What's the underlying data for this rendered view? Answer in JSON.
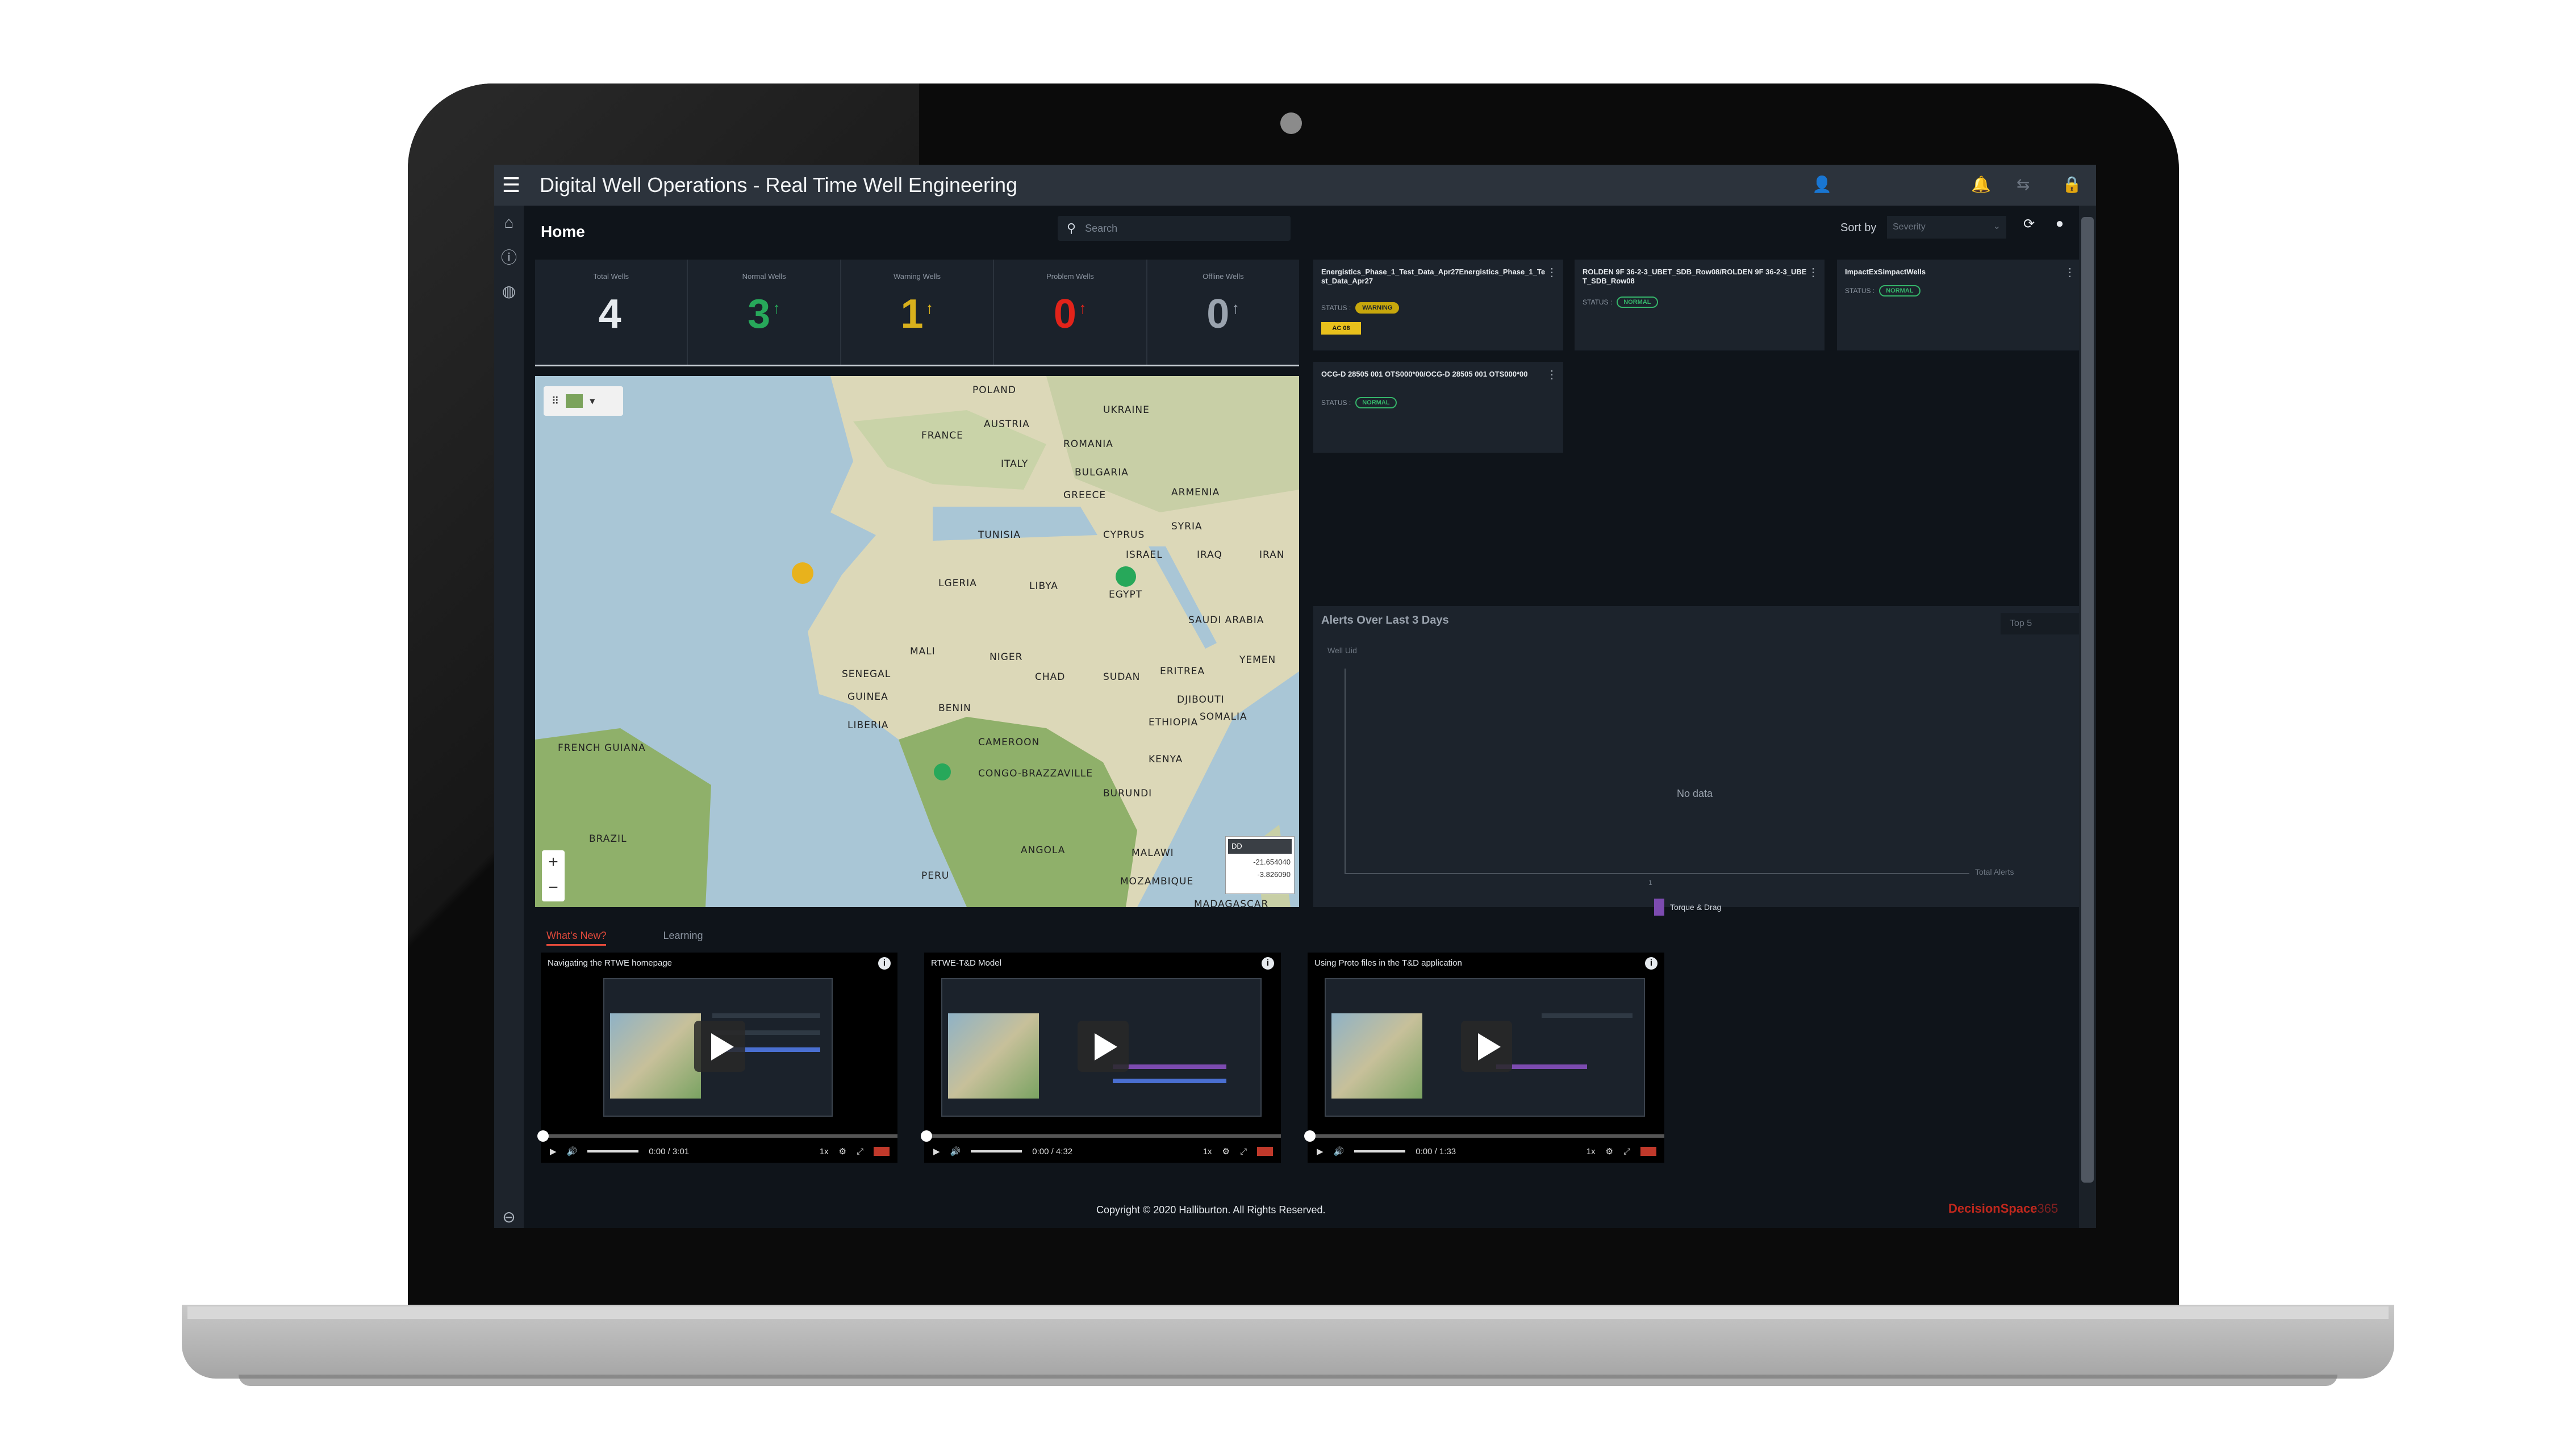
{
  "app": {
    "title": "Digital Well Operations - Real Time Well Engineering",
    "page": "Home",
    "search_placeholder": "Search",
    "sort_label": "Sort by",
    "sort_value": "Severity"
  },
  "kpis": [
    {
      "label": "Total Wells",
      "value": "4",
      "arrow": "",
      "color": "#e6eaee"
    },
    {
      "label": "Normal Wells",
      "value": "3",
      "arrow": "↑",
      "color": "#27a85a"
    },
    {
      "label": "Warning Wells",
      "value": "1",
      "arrow": "↑",
      "color": "#d8b01c"
    },
    {
      "label": "Problem Wells",
      "value": "0",
      "arrow": "↑",
      "color": "#e2231a"
    },
    {
      "label": "Offline Wells",
      "value": "0",
      "arrow": "↑",
      "color": "#9aa3ae"
    }
  ],
  "map": {
    "labels": [
      "POLAND",
      "UKRAINE",
      "FRANCE",
      "AUSTRIA",
      "ROMANIA",
      "ITALY",
      "BULGARIA",
      "GREECE",
      "ARMENIA",
      "TUNISIA",
      "CYPRUS",
      "SYRIA",
      "ISRAEL",
      "IRAQ",
      "IRAN",
      "LGERIA",
      "LIBYA",
      "EGYPT",
      "SAUDI ARABIA",
      "MALI",
      "NIGER",
      "CHAD",
      "SUDAN",
      "ERITREA",
      "YEMEN",
      "SENEGAL",
      "GUINEA",
      "BENIN",
      "DJIBOUTI",
      "SOMALIA",
      "LIBERIA",
      "ETHIOPIA",
      "CAMEROON",
      "KENYA",
      "CONGO-BRAZZAVILLE",
      "BURUNDI",
      "FRENCH GUIANA",
      "BRAZIL",
      "ANGOLA",
      "MALAWI",
      "MOZAMBIQUE",
      "MADAGASCAR",
      "PERU"
    ],
    "zoom_in": "+",
    "zoom_out": "−",
    "coord_header": "DD",
    "coord_lat": "-21.654040",
    "coord_lon": "-3.826090"
  },
  "well_cards": [
    {
      "title": "Energistics_Phase_1_Test_Data_Apr27Energistics_Phase_1_Test_Data_Apr27",
      "status_label": "STATUS :",
      "status": "WARNING",
      "tag": "AC 08"
    },
    {
      "title": "ROLDEN 9F 36-2-3_UBET_SDB_Row08/ROLDEN 9F 36-2-3_UBET_SDB_Row08",
      "status_label": "STATUS :",
      "status": "NORMAL"
    },
    {
      "title": "ImpactExSimpactWells",
      "status_label": "STATUS :",
      "status": "NORMAL"
    },
    {
      "title": "OCG-D 28505 001 OTS000*00/OCG-D 28505 001 OTS000*00",
      "status_label": "STATUS :",
      "status": "NORMAL"
    }
  ],
  "alerts": {
    "title": "Alerts Over Last 3 Days",
    "select": "Top 5",
    "y_title": "Well Uid",
    "x_title": "Total Alerts",
    "empty": "No data",
    "x_tick": "1",
    "legend": "Torque & Drag",
    "legend_color": "#7c4bb0"
  },
  "tabs": [
    "What's New?",
    "Learning"
  ],
  "videos": [
    {
      "title": "Navigating the RTWE homepage",
      "time": "0:00 / 3:01",
      "speed": "1x"
    },
    {
      "title": "RTWE-T&D Model",
      "time": "0:00 / 4:32",
      "speed": "1x"
    },
    {
      "title": "Using Proto files in the T&D application",
      "time": "0:00 / 1:33",
      "speed": "1x"
    }
  ],
  "footer": {
    "copyright": "Copyright © 2020 Halliburton. All Rights Reserved.",
    "brand": "DecisionSpace",
    "brand_suffix": "365"
  }
}
